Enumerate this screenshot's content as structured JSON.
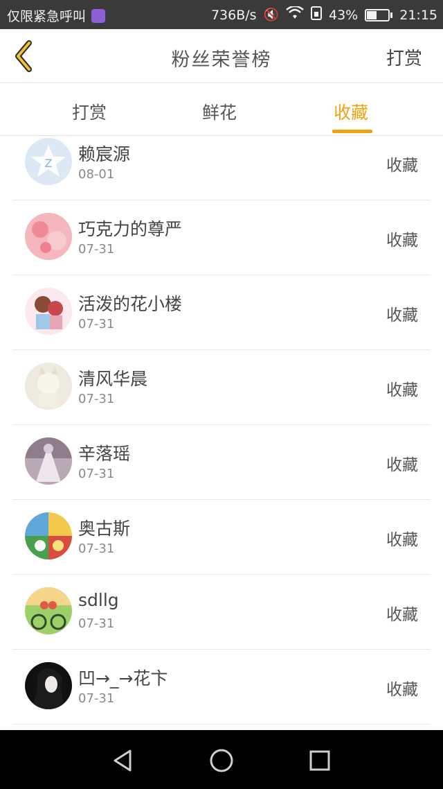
{
  "status_bar": {
    "carrier": "仅限紧急呼叫",
    "speed": "736B/s",
    "battery": "43%",
    "time": "21:15",
    "battery_level": 0.43
  },
  "header": {
    "title": "粉丝荣誉榜",
    "action": "打赏"
  },
  "tabs": [
    {
      "label": "打赏",
      "active": false
    },
    {
      "label": "鲜花",
      "active": false
    },
    {
      "label": "收藏",
      "active": true
    }
  ],
  "accent_color": "#f3a20f",
  "list": [
    {
      "name": "赖宸源",
      "date": "08-01",
      "tag": "收藏"
    },
    {
      "name": "巧克力的尊严",
      "date": "07-31",
      "tag": "收藏"
    },
    {
      "name": "活泼的花小楼",
      "date": "07-31",
      "tag": "收藏"
    },
    {
      "name": "清风华晨",
      "date": "07-31",
      "tag": "收藏"
    },
    {
      "name": "辛落瑶",
      "date": "07-31",
      "tag": "收藏"
    },
    {
      "name": "奥古斯",
      "date": "07-31",
      "tag": "收藏"
    },
    {
      "name": "sdllg",
      "date": "07-31",
      "tag": "收藏"
    },
    {
      "name": "凹→_→花卞",
      "date": "07-31",
      "tag": "收藏"
    }
  ]
}
